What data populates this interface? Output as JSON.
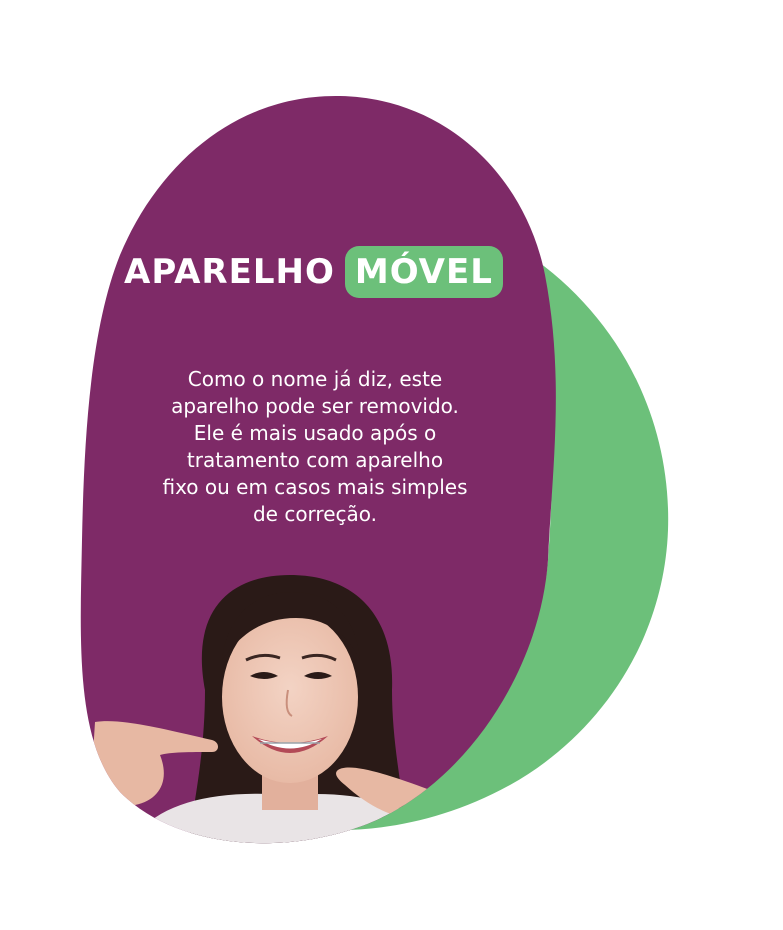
{
  "title": {
    "word_1": "APARELHO",
    "word_2": "MÓVEL"
  },
  "description": "Como o nome já diz, este\naparelho pode ser removido.\nEle é mais usado após o\ntratamento com aparelho\nfixo ou em casos mais simples\nde correção.",
  "colors": {
    "purple": "#7e2a67",
    "green": "#6cc07a",
    "white": "#ffffff"
  },
  "photo": {
    "subject": "smiling-woman-with-braces-pointing-at-teeth"
  }
}
